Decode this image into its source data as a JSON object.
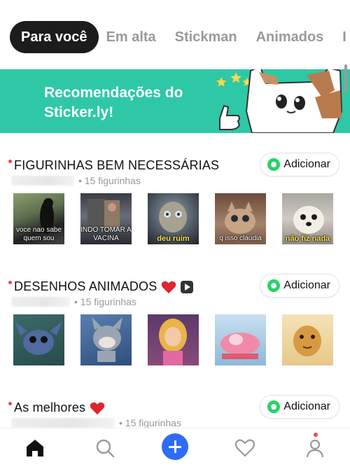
{
  "tabs": [
    {
      "label": "Para você",
      "active": true
    },
    {
      "label": "Em alta",
      "active": false
    },
    {
      "label": "Stickman",
      "active": false
    },
    {
      "label": "Animados",
      "active": false
    },
    {
      "label": "I",
      "active": false
    }
  ],
  "banner": {
    "line1": "Recomendações do",
    "line2": "Sticker.ly!",
    "background": "#2ec8a6"
  },
  "packs": [
    {
      "title": "FIGURINHAS BEM NECESSÁRIAS",
      "count": "• 15 figurinhas",
      "add_label": "Adicionar",
      "stickers": [
        {
          "caption": "voce nao sabe quem sou",
          "style": "white"
        },
        {
          "caption": "INDO TOMAR A VACINA",
          "style": "white"
        },
        {
          "caption": "deu ruim",
          "style": "yellow"
        },
        {
          "caption": "q isso claudia",
          "style": "white"
        },
        {
          "caption": "não fiz nada",
          "style": "yellow"
        }
      ]
    },
    {
      "title": "DESENHOS ANIMADOS",
      "count": "• 15 figurinhas",
      "add_label": "Adicionar",
      "icons": [
        "heart-emoji",
        "video-icon"
      ]
    },
    {
      "title": "As melhores",
      "count": "• 15 figurinhas",
      "add_label": "Adicionar",
      "icons": [
        "heart-emoji"
      ]
    }
  ],
  "bottom_nav": [
    "home-icon",
    "search-icon",
    "add-icon",
    "heart-icon",
    "profile-icon"
  ],
  "colors": {
    "accent": "#2f6cf6",
    "whatsapp": "#25d366",
    "notification": "#ea4a4a"
  }
}
